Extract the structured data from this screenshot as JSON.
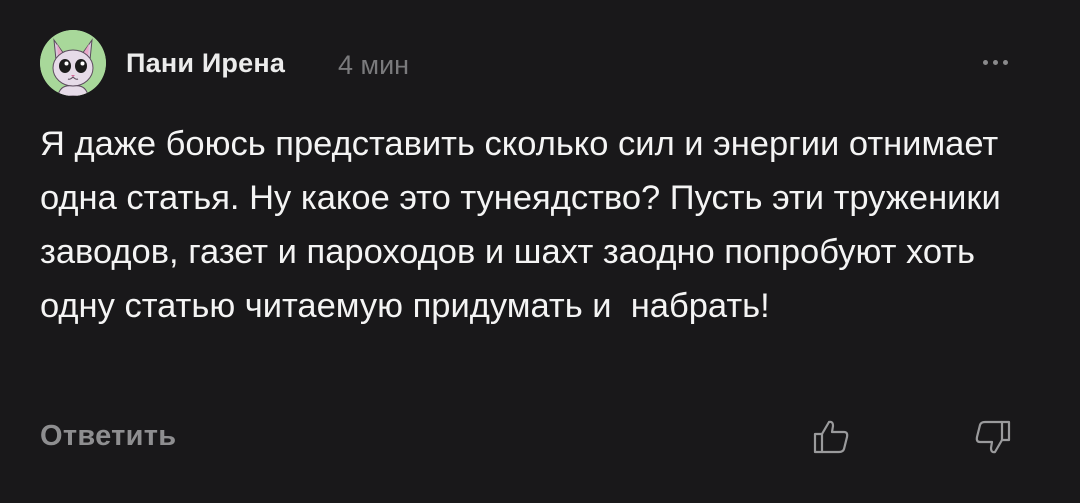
{
  "comment": {
    "author": "Пани Ирена",
    "time": "4 мин",
    "text": "Я даже боюсь представить сколько сил и энергии отнимает одна статья. Ну какое это тунеядство? Пусть эти труженики заводов, газет и пароходов и шахт заодно попробуют хоть одну статью читаемую придумать и  набрать!",
    "avatar_icon": "cat-avatar",
    "more_icon": "more-dots-icon"
  },
  "actions": {
    "reply_label": "Ответить",
    "like_icon": "thumb-up-icon",
    "dislike_icon": "thumb-down-icon"
  },
  "colors": {
    "background": "#19181a",
    "text": "#f4f4f4",
    "muted": "#7a7a7c",
    "avatar_bg": "#a8d89a"
  }
}
